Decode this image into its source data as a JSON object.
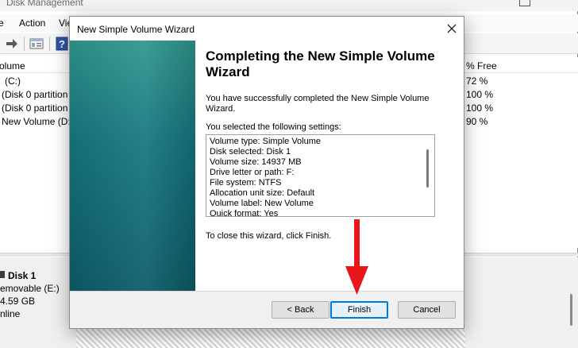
{
  "background": {
    "window_title": "Disk Management",
    "menu": [
      "Action",
      "Vie"
    ],
    "columns": {
      "volume": "olume",
      "percent_free": "% Free"
    },
    "volumes": [
      {
        "name": "(C:)",
        "free": "72 %"
      },
      {
        "name": "(Disk 0 partition",
        "free": "100 %"
      },
      {
        "name": "(Disk 0 partition",
        "free": "100 %"
      },
      {
        "name": "New Volume (D:",
        "free": "90 %"
      }
    ],
    "disk": {
      "title": "Disk 1",
      "type": "emovable (E:)",
      "size": "4.59 GB",
      "status": "nline"
    }
  },
  "wizard": {
    "title": "New Simple Volume Wizard",
    "heading": "Completing the New Simple Volume Wizard",
    "intro": "You have successfully completed the New Simple Volume Wizard.",
    "settings_label": "You selected the following settings:",
    "settings": [
      "Volume type: Simple Volume",
      "Disk selected: Disk 1",
      "Volume size: 14937 MB",
      "Drive letter or path: F:",
      "File system: NTFS",
      "Allocation unit size: Default",
      "Volume label: New Volume",
      "Quick format: Yes"
    ],
    "close_hint": "To close this wizard, click Finish.",
    "buttons": {
      "back": "< Back",
      "finish": "Finish",
      "cancel": "Cancel"
    }
  },
  "colors": {
    "accent": "#0078d7",
    "sidebar_teal": "#167780",
    "annotation_red": "#e8161b"
  }
}
